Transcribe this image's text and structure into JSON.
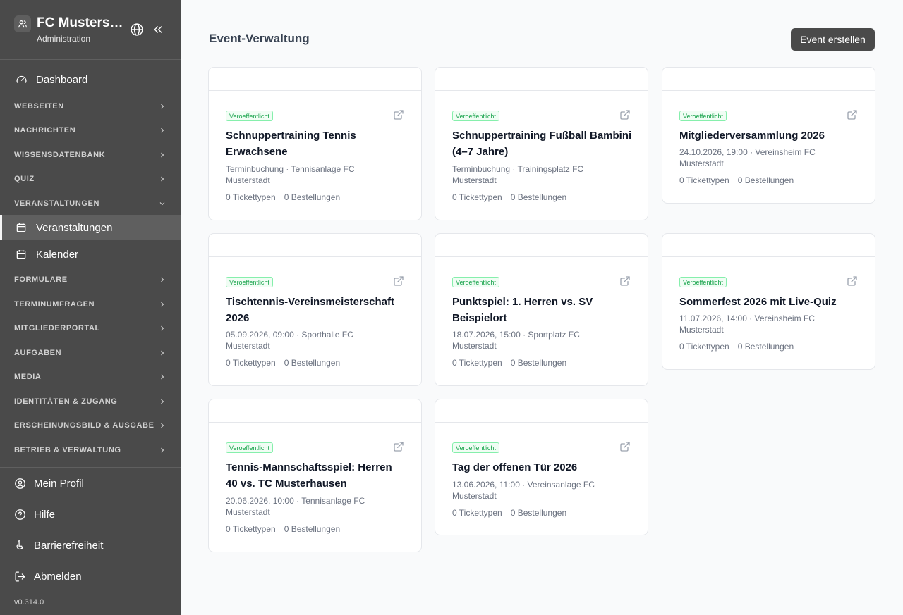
{
  "brand": {
    "title": "FC Musterstadt",
    "subtitle": "Administration"
  },
  "nav": {
    "dashboard": "Dashboard",
    "sections": {
      "webseiten": "WEBSEITEN",
      "nachrichten": "NACHRICHTEN",
      "wissensdatenbank": "WISSENSDATENBANK",
      "quiz": "QUIZ",
      "veranstaltungen": "VERANSTALTUNGEN",
      "formulare": "FORMULARE",
      "terminumfragen": "TERMINUMFRAGEN",
      "mitgliederportal": "MITGLIEDERPORTAL",
      "aufgaben": "AUFGABEN",
      "media": "MEDIA",
      "identitaeten": "IDENTITÄTEN & ZUGANG",
      "erscheinungsbild": "ERSCHEINUNGSBILD & AUSGABE",
      "betrieb": "BETRIEB & VERWALTUNG"
    },
    "sub": {
      "veranstaltungen": "Veranstaltungen",
      "kalender": "Kalender"
    }
  },
  "footer": {
    "profil": "Mein Profil",
    "hilfe": "Hilfe",
    "barrierefreiheit": "Barrierefreiheit",
    "abmelden": "Abmelden",
    "version": "v0.314.0"
  },
  "main": {
    "title": "Event-Verwaltung",
    "create_button": "Event erstellen",
    "badge_label": "Veroeffentlicht",
    "events": [
      {
        "title": "Schnuppertraining Tennis Erwachsene",
        "meta": "Terminbuchung · Tennisanlage FC Musterstadt",
        "tickets": "0 Tickettypen",
        "orders": "0 Bestellungen"
      },
      {
        "title": "Schnuppertraining Fußball Bambini (4–7 Jahre)",
        "meta": "Terminbuchung · Trainingsplatz FC Musterstadt",
        "tickets": "0 Tickettypen",
        "orders": "0 Bestellungen"
      },
      {
        "title": "Mitgliederversammlung 2026",
        "meta": "24.10.2026, 19:00 · Vereinsheim FC Musterstadt",
        "tickets": "0 Tickettypen",
        "orders": "0 Bestellungen"
      },
      {
        "title": "Tischtennis-Vereinsmeisterschaft 2026",
        "meta": "05.09.2026, 09:00 · Sporthalle FC Musterstadt",
        "tickets": "0 Tickettypen",
        "orders": "0 Bestellungen"
      },
      {
        "title": "Punktspiel: 1. Herren vs. SV Beispielort",
        "meta": "18.07.2026, 15:00 · Sportplatz FC Musterstadt",
        "tickets": "0 Tickettypen",
        "orders": "0 Bestellungen"
      },
      {
        "title": "Sommerfest 2026 mit Live-Quiz",
        "meta": "11.07.2026, 14:00 · Vereinsheim FC Musterstadt",
        "tickets": "0 Tickettypen",
        "orders": "0 Bestellungen"
      },
      {
        "title": "Tennis-Mannschaftsspiel: Herren 40 vs. TC Musterhausen",
        "meta": "20.06.2026, 10:00 · Tennisanlage FC Musterstadt",
        "tickets": "0 Tickettypen",
        "orders": "0 Bestellungen"
      },
      {
        "title": "Tag der offenen Tür 2026",
        "meta": "13.06.2026, 11:00 · Vereinsanlage FC Musterstadt",
        "tickets": "0 Tickettypen",
        "orders": "0 Bestellungen"
      }
    ]
  },
  "icons": {
    "logo": "users-icon",
    "globe": "globe-icon",
    "collapse": "chevrons-left-icon",
    "dashboard": "gauge-icon",
    "calendar": "calendar-icon",
    "external": "external-link-icon",
    "chevron": "chevron-right-icon"
  }
}
